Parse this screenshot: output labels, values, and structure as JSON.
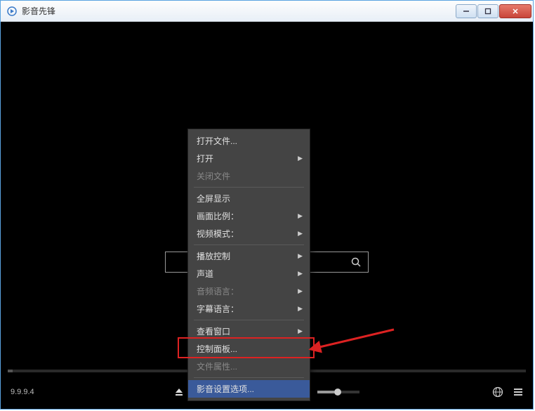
{
  "window": {
    "title": "影音先锋"
  },
  "logo": "y",
  "search": {
    "placeholder": ""
  },
  "menu": {
    "items": [
      {
        "label": "打开文件...",
        "disabled": false,
        "submenu": false,
        "sep": false
      },
      {
        "label": "打开",
        "disabled": false,
        "submenu": true,
        "sep": false
      },
      {
        "label": "关闭文件",
        "disabled": true,
        "submenu": false,
        "sep": true
      },
      {
        "label": "全屏显示",
        "disabled": false,
        "submenu": false,
        "sep": false
      },
      {
        "label": "画面比例：",
        "disabled": false,
        "submenu": true,
        "sep": false
      },
      {
        "label": "视频模式：",
        "disabled": false,
        "submenu": true,
        "sep": true
      },
      {
        "label": "播放控制",
        "disabled": false,
        "submenu": true,
        "sep": false
      },
      {
        "label": "声道",
        "disabled": false,
        "submenu": true,
        "sep": false
      },
      {
        "label": "音频语言：",
        "disabled": true,
        "submenu": true,
        "sep": false
      },
      {
        "label": "字幕语言：",
        "disabled": false,
        "submenu": true,
        "sep": true
      },
      {
        "label": "查看窗口",
        "disabled": false,
        "submenu": true,
        "sep": false
      },
      {
        "label": "控制面板...",
        "disabled": false,
        "submenu": false,
        "sep": false
      },
      {
        "label": "文件属性...",
        "disabled": true,
        "submenu": false,
        "sep": true
      },
      {
        "label": "影音设置选项...",
        "disabled": false,
        "submenu": false,
        "sep": false,
        "highlighted": true
      }
    ]
  },
  "controls": {
    "version": "9.9.9.4"
  }
}
